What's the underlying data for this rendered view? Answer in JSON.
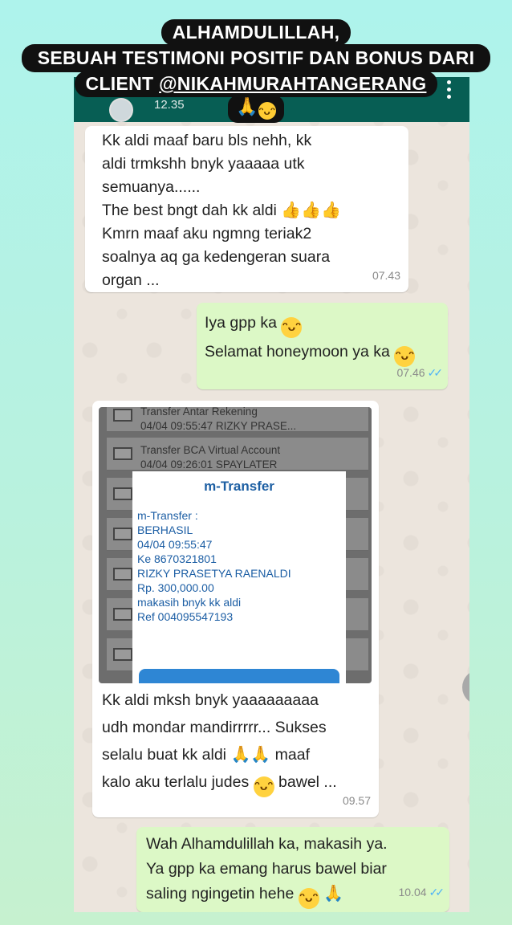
{
  "story": {
    "headline_line1": "ALHAMDULILLAH,",
    "headline_line2": "SEBUAH TESTIMONI POSITIF DAN BONUS DARI",
    "headline_line3_prefix": "CLIENT ",
    "headline_handle": "@NIKAHMURAHTANGERANG",
    "headline_emoji": "🙏"
  },
  "appbar": {
    "time": "12.35"
  },
  "messages": [
    {
      "direction": "in",
      "lines": [
        "Kk aldi maaf baru bls nehh, kk",
        "aldi trmkshh bnyk yaaaaa utk",
        "semuanya......",
        "The best bngt dah kk aldi",
        "Kmrn maaf aku ngmng teriak2",
        "soalnya aq ga kedengeran suara",
        "organ ..."
      ],
      "time": "07.43"
    },
    {
      "direction": "out",
      "lines": [
        "Iya gpp ka",
        "Selamat honeymoon ya ka"
      ],
      "time": "07.46"
    },
    {
      "direction": "in",
      "image": {
        "rows": [
          {
            "line1": "Transfer Antar Rekening",
            "line2": "04/04 09:55:47 RIZKY PRASE..."
          },
          {
            "line1": "Transfer BCA Virtual Account",
            "line2": "04/04 09:26:01 SPAYLATER"
          }
        ],
        "popup_title": "m-Transfer",
        "popup_lines": [
          "m-Transfer :",
          "BERHASIL",
          "04/04 09:55:47",
          "Ke 8670321801",
          "RIZKY PRASETYA RAENALDI",
          "Rp. 300,000.00",
          "makasih bnyk kk aldi",
          "Ref 004095547193"
        ]
      },
      "lines": [
        "Kk aldi mksh bnyk yaaaaaaaaa",
        "udh mondar mandirrrrr... Sukses",
        "selalu buat kk aldi",
        "maaf",
        "kalo aku terlalu judes",
        "bawel ..."
      ],
      "time": "09.57"
    },
    {
      "direction": "out",
      "lines": [
        "Wah Alhamdulillah ka, makasih ya.",
        "Ya gpp ka emang harus bawel biar",
        "saling ngingetin hehe"
      ],
      "time": "10.04"
    }
  ]
}
